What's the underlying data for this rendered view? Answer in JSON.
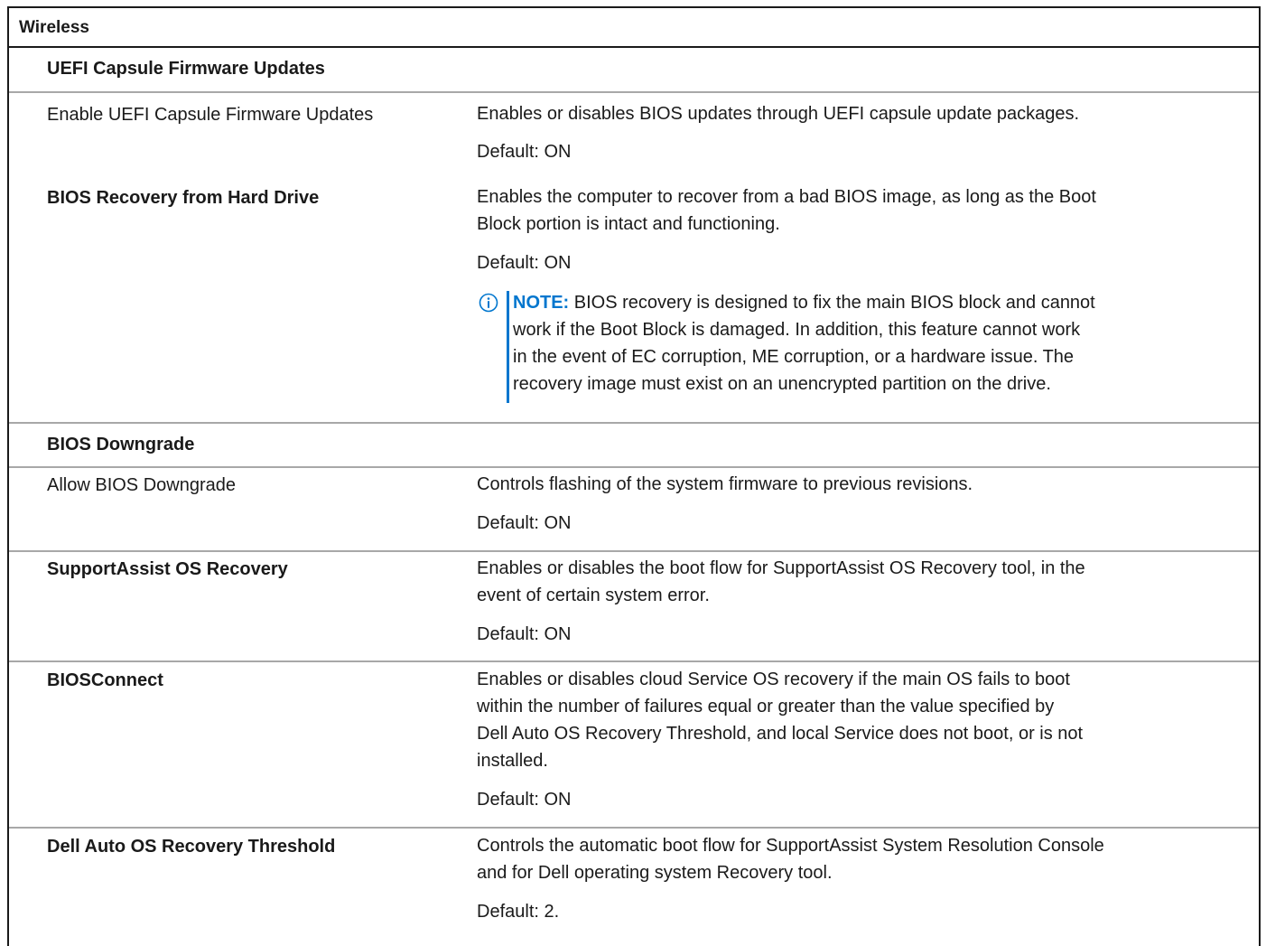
{
  "table": {
    "title": "Wireless",
    "sections": {
      "uefi": "UEFI Capsule Firmware Updates",
      "downgrade": "BIOS Downgrade"
    },
    "rows": {
      "uefi_enable": {
        "label": "Enable UEFI Capsule Firmware Updates",
        "description": "Enables or disables BIOS updates through UEFI capsule update packages.",
        "default": "Default: ON"
      },
      "bios_recovery": {
        "label": "BIOS Recovery from Hard Drive",
        "description_line1": "Enables the computer to recover from a bad BIOS image, as long as the Boot",
        "description_line2": "Block portion is intact and functioning.",
        "default": "Default: ON",
        "note_keyword": "NOTE:",
        "note_line1": " BIOS recovery is designed to fix the main BIOS block and cannot",
        "note_line2": "work if the Boot Block is damaged. In addition, this feature cannot work",
        "note_line3": "in the event of EC corruption, ME corruption, or a hardware issue. The",
        "note_line4": "recovery image must exist on an unencrypted partition on the drive."
      },
      "allow_downgrade": {
        "label": "Allow BIOS Downgrade",
        "description": "Controls flashing of the system firmware to previous revisions.",
        "default": "Default: ON"
      },
      "supportassist": {
        "label": "SupportAssist OS Recovery",
        "description_line1": "Enables or disables the boot flow for SupportAssist OS Recovery tool, in the",
        "description_line2": "event of certain system error.",
        "default": "Default: ON"
      },
      "biosconnect": {
        "label": "BIOSConnect",
        "description_line1": "Enables or disables cloud Service OS recovery if the main OS fails to boot",
        "description_line2": "within the number of failures equal or greater than the value specified by",
        "description_line3": "Dell Auto OS Recovery Threshold, and local Service does not boot, or is not",
        "description_line4": "installed.",
        "default": "Default: ON"
      },
      "threshold": {
        "label": "Dell Auto OS Recovery Threshold",
        "description_line1": "Controls the automatic boot flow for SupportAssist System Resolution Console",
        "description_line2": "and for Dell operating system Recovery tool.",
        "default": "Default: 2."
      }
    },
    "colors": {
      "note_accent": "#0076ce",
      "border": "#1a1a1a",
      "row_divider": "#a8a8a8"
    },
    "icons": {
      "note": "info-circle-icon"
    }
  }
}
